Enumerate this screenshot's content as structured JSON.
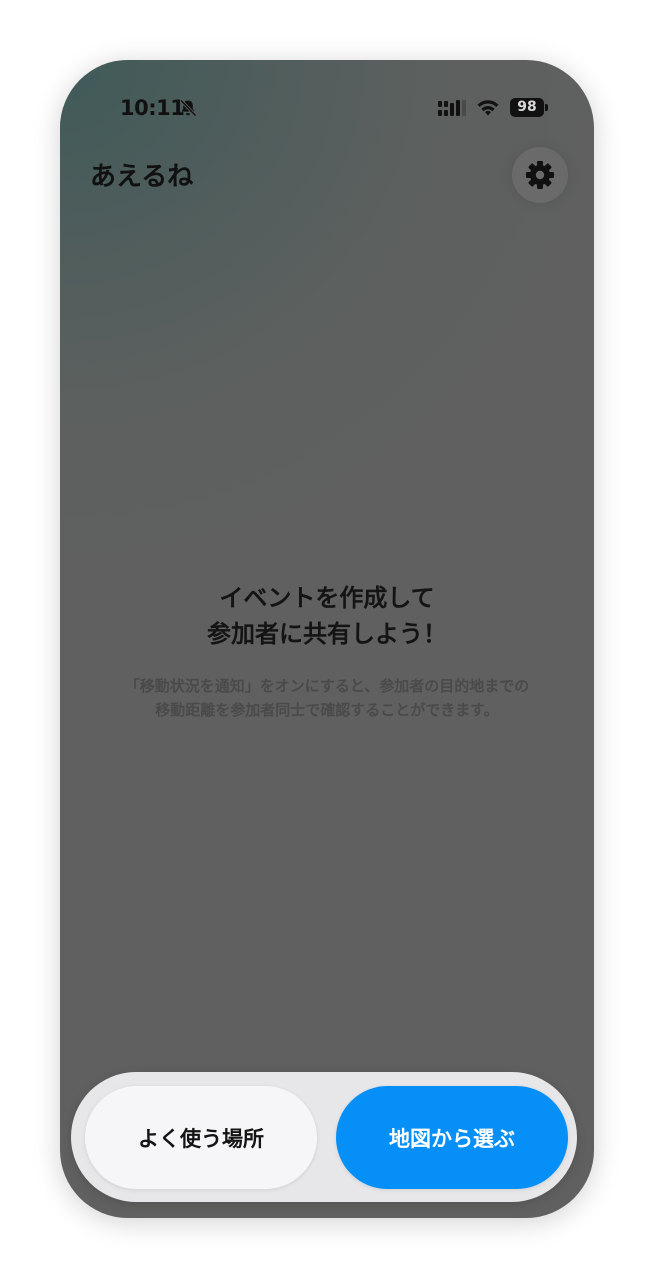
{
  "status_bar": {
    "time": "10:11",
    "battery_level": "98",
    "icons": [
      "bell-slash-icon",
      "signal-icon",
      "wifi-icon",
      "battery-icon"
    ]
  },
  "header": {
    "title": "あえるね",
    "settings_icon": "gear-icon"
  },
  "empty_state": {
    "title_lines": [
      "イベントを作成して",
      "参加者に共有しよう！"
    ],
    "description_lines": [
      "「移動状況を通知」をオンにすると、参加者の目的地までの",
      "移動距離を参加者同士で確認することができます。"
    ]
  },
  "bottom_bar": {
    "favorites_label": "よく使う場所",
    "map_label": "地図から選ぶ"
  },
  "colors": {
    "primary": "#068ff7",
    "overlay": "#606060"
  }
}
